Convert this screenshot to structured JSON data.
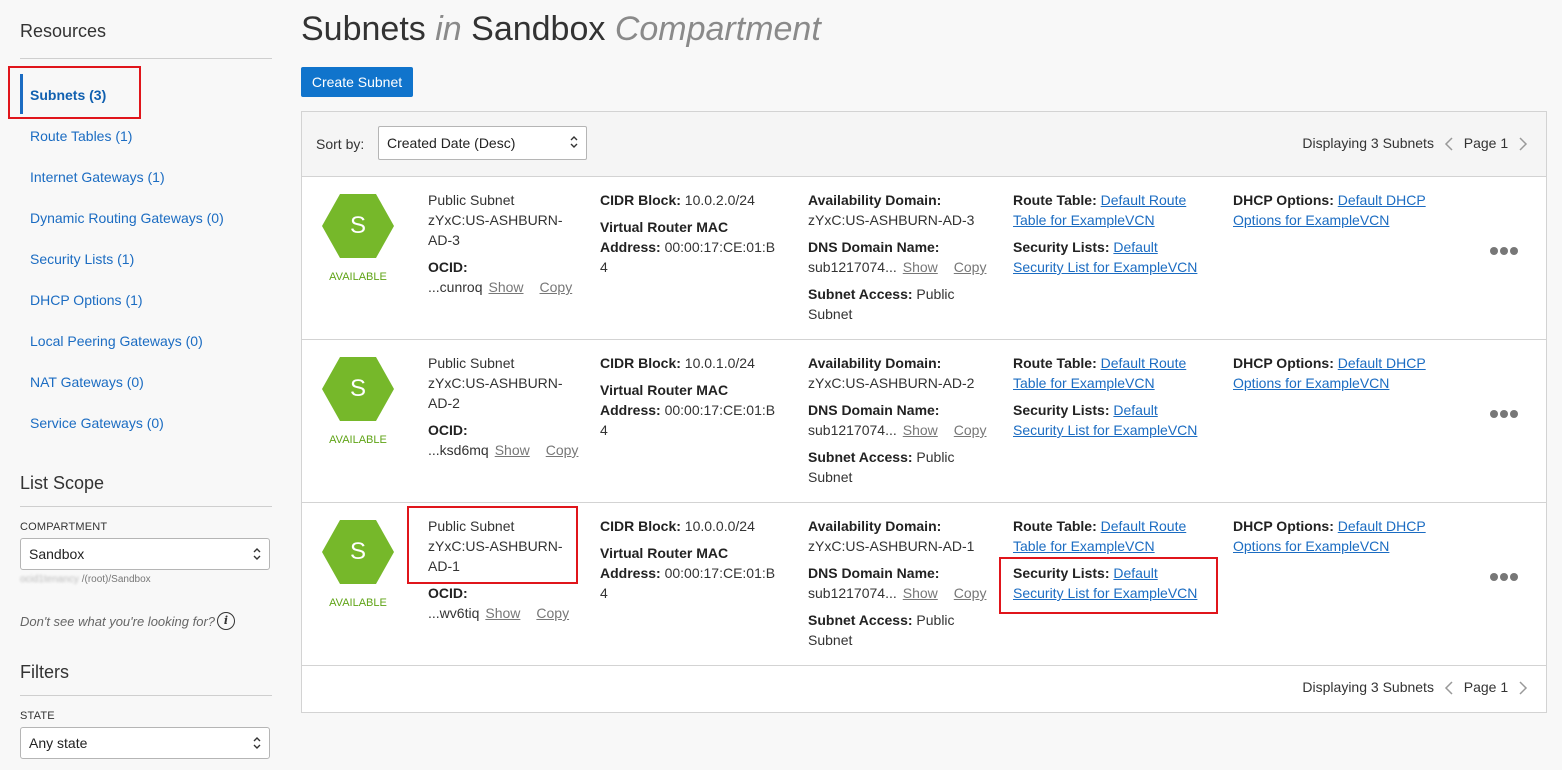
{
  "sidebar": {
    "resources_heading": "Resources",
    "nav": [
      {
        "label": "Subnets (3)",
        "active": true
      },
      {
        "label": "Route Tables (1)"
      },
      {
        "label": "Internet Gateways (1)"
      },
      {
        "label": "Dynamic Routing Gateways (0)"
      },
      {
        "label": "Security Lists (1)"
      },
      {
        "label": "DHCP Options (1)"
      },
      {
        "label": "Local Peering Gateways (0)"
      },
      {
        "label": "NAT Gateways (0)"
      },
      {
        "label": "Service Gateways (0)"
      }
    ],
    "list_scope_heading": "List Scope",
    "compartment_label": "COMPARTMENT",
    "compartment_value": "Sandbox",
    "compartment_path": "/(root)/Sandbox",
    "help_text": "Don't see what you're looking for?",
    "help_icon_glyph": "i",
    "filters_heading": "Filters",
    "state_label": "STATE",
    "state_value": "Any state"
  },
  "header": {
    "title_part1": "Subnets",
    "title_in": "in",
    "title_part2": "Sandbox",
    "title_part3": "Compartment",
    "create_button": "Create Subnet"
  },
  "toolbar": {
    "sort_label": "Sort by:",
    "sort_value": "Created Date (Desc)",
    "displaying": "Displaying 3 Subnets",
    "page": "Page 1"
  },
  "labels": {
    "ocid": "OCID:",
    "show": "Show",
    "copy": "Copy",
    "cidr": "CIDR Block:",
    "vr_mac_1": "Virtual Router MAC",
    "vr_mac_2": "Address:",
    "ad": "Availability Domain:",
    "dns": "DNS Domain Name:",
    "access": "Subnet Access:",
    "route_table": "Route Table:",
    "security_lists": "Security Lists:",
    "dhcp": "DHCP Options:"
  },
  "subnets": [
    {
      "icon_letter": "S",
      "state": "AVAILABLE",
      "name_line1": "Public Subnet",
      "name_line2": "zYxC:US-ASHBURN-",
      "name_line3": "AD-3",
      "ocid": "...cunroq",
      "cidr": "10.0.2.0/24",
      "mac_line1": "00:00:17:CE:01:B",
      "mac_line2": "4",
      "ad": "zYxC:US-ASHBURN-AD-3",
      "dns": "sub1217074...",
      "access_1": "Public",
      "access_2": "Subnet",
      "route_1": "Default Route",
      "route_2": "Table for ExampleVCN",
      "sec_1": "Default",
      "sec_2": "Security List for ExampleVCN",
      "dhcp_1": "Default DHCP",
      "dhcp_2": "Options for ExampleVCN"
    },
    {
      "icon_letter": "S",
      "state": "AVAILABLE",
      "name_line1": "Public Subnet",
      "name_line2": "zYxC:US-ASHBURN-",
      "name_line3": "AD-2",
      "ocid": "...ksd6mq",
      "cidr": "10.0.1.0/24",
      "mac_line1": "00:00:17:CE:01:B",
      "mac_line2": "4",
      "ad": "zYxC:US-ASHBURN-AD-2",
      "dns": "sub1217074...",
      "access_1": "Public",
      "access_2": "Subnet",
      "route_1": "Default Route",
      "route_2": "Table for ExampleVCN",
      "sec_1": "Default",
      "sec_2": "Security List for ExampleVCN",
      "dhcp_1": "Default DHCP",
      "dhcp_2": "Options for ExampleVCN"
    },
    {
      "icon_letter": "S",
      "state": "AVAILABLE",
      "name_line1": "Public Subnet",
      "name_line2": "zYxC:US-ASHBURN-",
      "name_line3": "AD-1",
      "ocid": "...wv6tiq",
      "cidr": "10.0.0.0/24",
      "mac_line1": "00:00:17:CE:01:B",
      "mac_line2": "4",
      "ad": "zYxC:US-ASHBURN-AD-1",
      "dns": "sub1217074...",
      "access_1": "Public",
      "access_2": "Subnet",
      "route_1": "Default Route",
      "route_2": "Table for ExampleVCN",
      "sec_1": "Default",
      "sec_2": "Security List for ExampleVCN",
      "dhcp_1": "Default DHCP",
      "dhcp_2": "Options for ExampleVCN"
    }
  ],
  "footer": {
    "displaying": "Displaying 3 Subnets",
    "page": "Page 1"
  },
  "colors": {
    "accent": "#1074cc",
    "link": "#1b6cc2",
    "available_green": "#76b82a",
    "highlight_red": "#e0151b"
  }
}
